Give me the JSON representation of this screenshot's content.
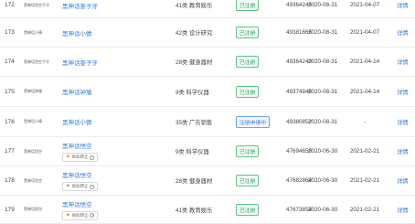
{
  "rows": [
    {
      "no": "172",
      "image_text": "黑神话悟空子牙",
      "name": "黑神话姜子牙",
      "claim": "",
      "category": "41类 教育娱乐",
      "status": "已注册",
      "status_color": "green",
      "reg_no": "49364245",
      "apply_date": "2020-08-31",
      "expire": "2021-04-07",
      "detail": "详情"
    },
    {
      "no": "173",
      "image_text": "黑神话小倩",
      "name": "黑神话小倩",
      "claim": "",
      "category": "42类 设计研究",
      "status": "已注册",
      "status_color": "green",
      "reg_no": "49381665",
      "apply_date": "2020-08-31",
      "expire": "2021-04-07",
      "detail": "详情"
    },
    {
      "no": "174",
      "image_text": "黑神话悟空子牙",
      "name": "黑神话姜子牙",
      "claim": "",
      "category": "28类 健身器材",
      "status": "已注册",
      "status_color": "green",
      "reg_no": "49364240",
      "apply_date": "2020-08-31",
      "expire": "2021-04-14",
      "detail": "详情"
    },
    {
      "no": "175",
      "image_text": "黑神话钟馗",
      "name": "黑神话钟馗",
      "claim": "",
      "category": "9类 科学仪器",
      "status": "已注册",
      "status_color": "green",
      "reg_no": "49374846",
      "apply_date": "2020-08-31",
      "expire": "2021-04-14",
      "detail": "详情"
    },
    {
      "no": "176",
      "image_text": "黑神话小倩",
      "name": "黑神话小倩",
      "claim": "",
      "category": "35类 广告销售",
      "status": "注册申请中",
      "status_color": "blue",
      "reg_no": "49380852",
      "apply_date": "2020-08-31",
      "expire": "-",
      "detail": "详情"
    },
    {
      "no": "177",
      "image_text": "黑神话悟空",
      "name": "黑神话悟空",
      "claim": "商标转让",
      "category": "9类 科学仪器",
      "status": "已注册",
      "status_color": "green",
      "reg_no": "47694650",
      "apply_date": "2020-06-30",
      "expire": "2021-02-21",
      "detail": "详情"
    },
    {
      "no": "178",
      "image_text": "黑神话悟空",
      "name": "黑神话悟空",
      "claim": "商标转让",
      "category": "28类 健身器材",
      "status": "已注册",
      "status_color": "green",
      "reg_no": "47682864",
      "apply_date": "2020-06-30",
      "expire": "2021-02-21",
      "detail": "详情"
    },
    {
      "no": "179",
      "image_text": "黑神话悟空",
      "name": "黑神话悟空",
      "claim": "商标转让",
      "category": "41类 教育娱乐",
      "status": "已注册",
      "status_color": "green",
      "reg_no": "47673854",
      "apply_date": "2020-06-30",
      "expire": "2021-02-21",
      "detail": "详情"
    }
  ]
}
